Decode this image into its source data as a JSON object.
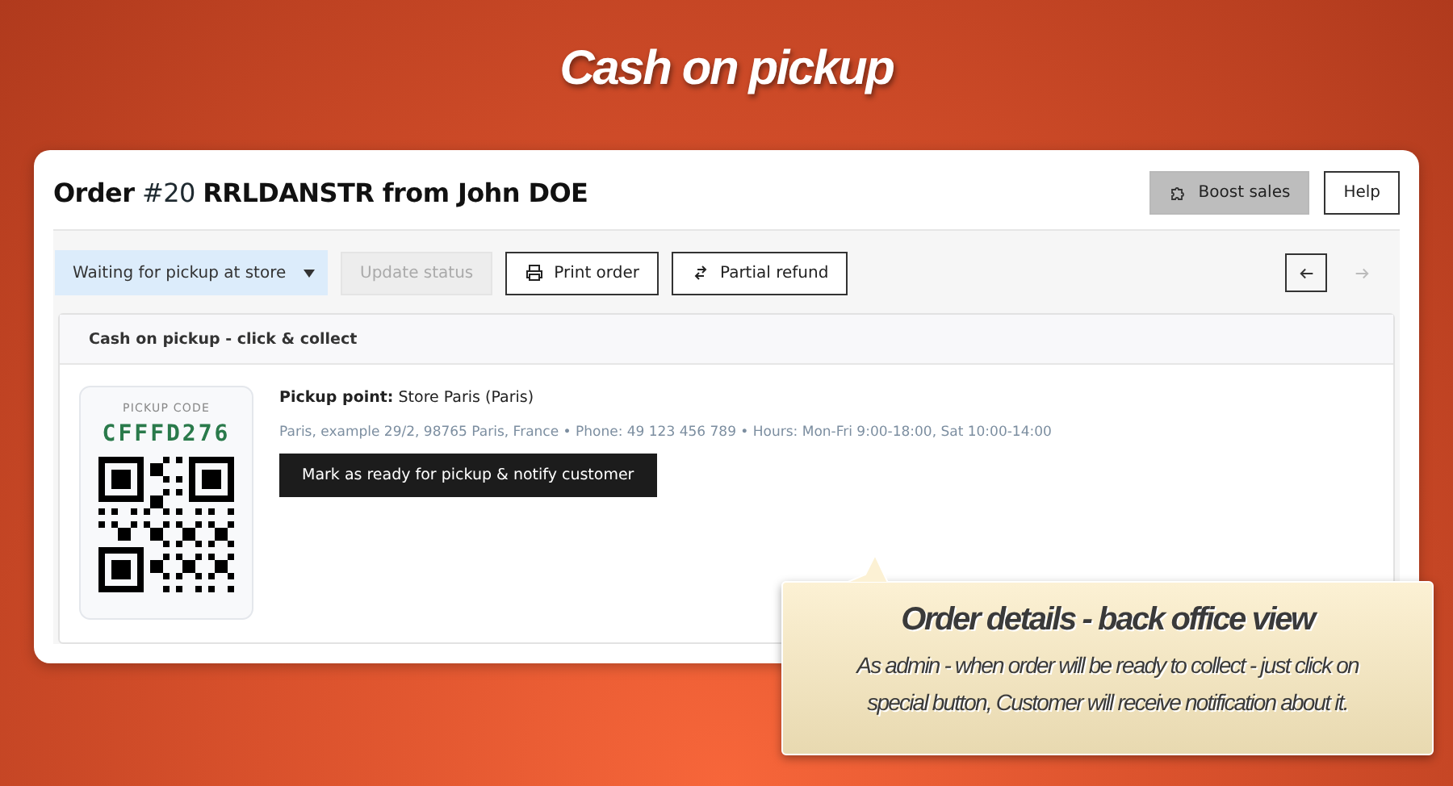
{
  "banner": {
    "title": "Cash on pickup"
  },
  "order": {
    "title": "**Order** #20 **RRLDANSTR from John DOE**"
  },
  "header_buttons": [
    {
      "kind": "boost",
      "label": "Boost sales"
    },
    {
      "kind": "plain",
      "label": "Help"
    }
  ],
  "toolbar": {
    "status_select": {
      "value": "Waiting for pickup at store"
    },
    "buttons": [
      {
        "kind": "plain",
        "label": "Update status",
        "disabled": true
      },
      {
        "kind": "print",
        "label": "Print order",
        "disabled": false
      },
      {
        "kind": "refund",
        "label": "Partial refund",
        "disabled": false
      }
    ],
    "nav": [
      {
        "kind": "prev",
        "disabled": false
      },
      {
        "kind": "next",
        "disabled": true
      }
    ]
  },
  "panel": {
    "title": "Cash on pickup - click & collect",
    "pickup_code": {
      "label": "PICKUP CODE",
      "code": "CFFFD276"
    },
    "pickup_point": "**Pickup point:** Store Paris (Paris)",
    "address": "Paris, example 29/2, 98765 Paris, France • Phone: 49 123 456 789 • Hours: Mon-Fri 9:00-18:00, Sat 10:00-14:00",
    "action_button": "Mark as ready for pickup & notify customer"
  },
  "callout": {
    "title": "Order details - back office view",
    "text": "As admin - when order will be ready to collect - just click on special button, Customer will receive notification about it."
  }
}
